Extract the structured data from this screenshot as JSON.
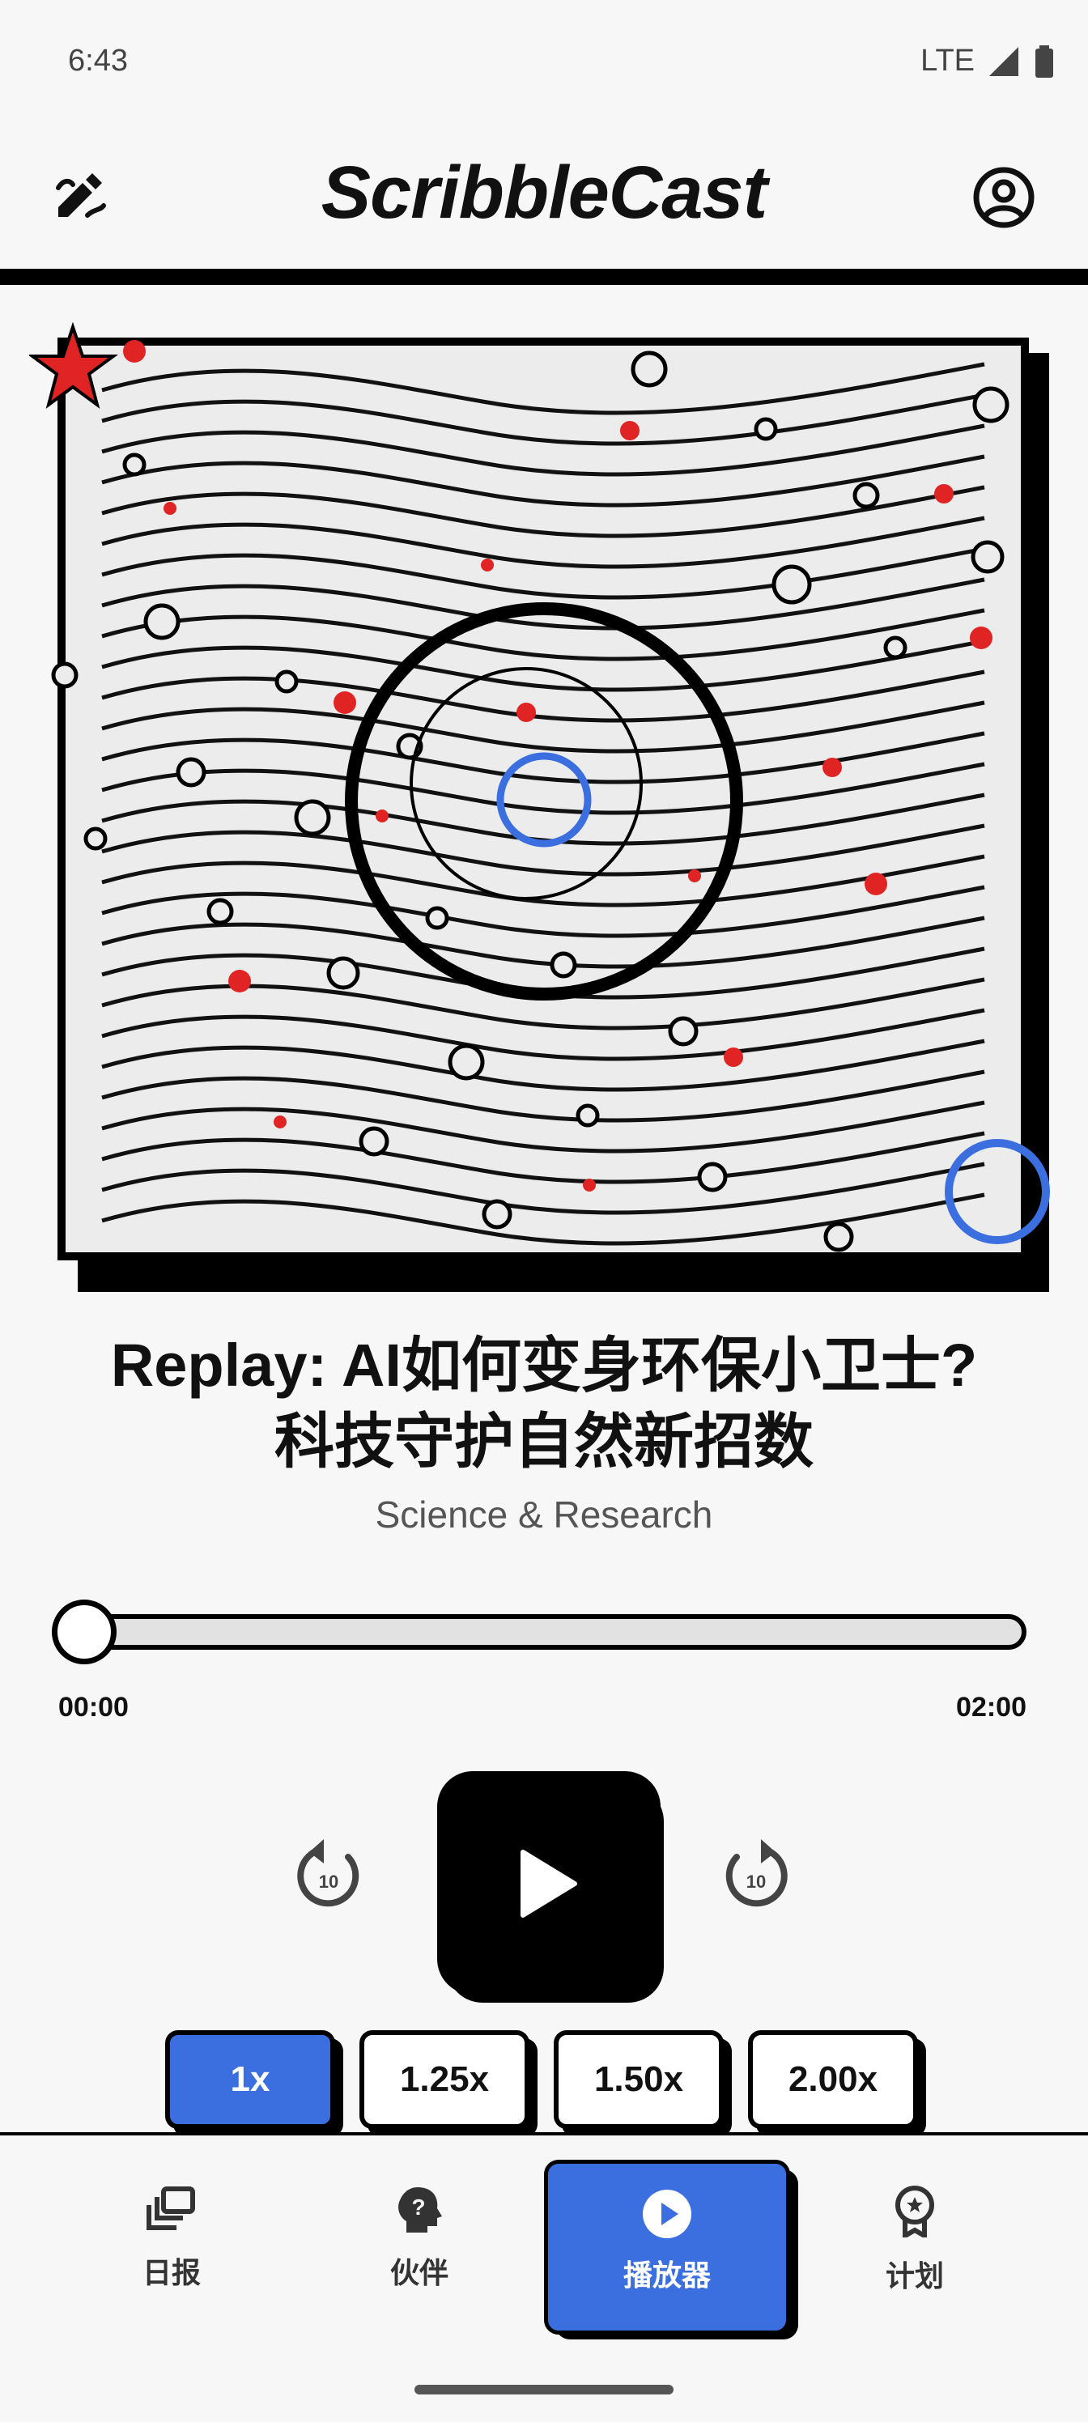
{
  "status_bar": {
    "time": "6:43",
    "network": "LTE"
  },
  "header": {
    "title": "ScribbleCast"
  },
  "episode": {
    "title_line1": "Replay: AI如何变身环保小卫士?",
    "title_line2": "科技守护自然新招数",
    "category": "Science & Research"
  },
  "player": {
    "current_time": "00:00",
    "total_time": "02:00",
    "progress": 0.0
  },
  "speeds": [
    {
      "label": "1x",
      "active": true
    },
    {
      "label": "1.25x",
      "active": false
    },
    {
      "label": "1.50x",
      "active": false
    },
    {
      "label": "2.00x",
      "active": false
    }
  ],
  "nav": {
    "daily": "日报",
    "partner": "伙伴",
    "player": "播放器",
    "plan": "计划"
  },
  "colors": {
    "accent": "#3b6fe0",
    "red": "#e02424"
  },
  "icons": [
    "edit-icon",
    "account-icon",
    "replay-10-icon",
    "forward-10-icon",
    "play-icon",
    "library-icon",
    "help-head-icon",
    "play-circle-icon",
    "award-icon"
  ]
}
